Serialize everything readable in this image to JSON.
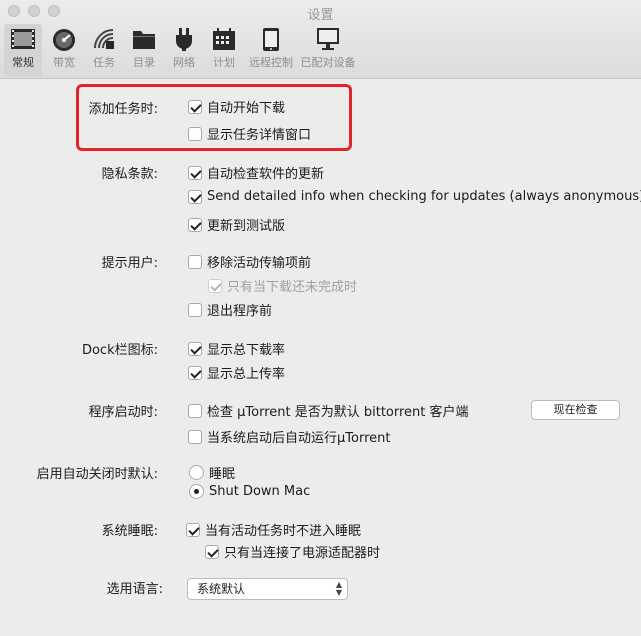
{
  "window": {
    "title": "设置"
  },
  "toolbar": {
    "tabs": [
      {
        "label": "常规"
      },
      {
        "label": "带宽"
      },
      {
        "label": "任务"
      },
      {
        "label": "目录"
      },
      {
        "label": "网络"
      },
      {
        "label": "计划"
      },
      {
        "label": "远程控制"
      },
      {
        "label": "已配对设备"
      }
    ],
    "active_tab": "常规"
  },
  "sections": {
    "add_task": {
      "label": "添加任务时:",
      "options": [
        {
          "text": "自动开始下载",
          "checked": true
        },
        {
          "text": "显示任务详情窗口",
          "checked": false
        }
      ]
    },
    "privacy": {
      "label": "隐私条款:",
      "options": [
        {
          "text": "自动检查软件的更新",
          "checked": true
        },
        {
          "text": "Send detailed info when checking for updates (always anonymous)",
          "checked": true
        },
        {
          "text": "更新到测试版",
          "checked": true
        }
      ]
    },
    "notify": {
      "label": "提示用户:",
      "options": [
        {
          "text": "移除活动传输项前",
          "checked": false
        },
        {
          "text": "只有当下载还未完成时",
          "checked": true,
          "disabled": true
        },
        {
          "text": "退出程序前",
          "checked": false
        }
      ]
    },
    "dock": {
      "label": "Dock栏图标:",
      "options": [
        {
          "text": "显示总下载率",
          "checked": true
        },
        {
          "text": "显示总上传率",
          "checked": true
        }
      ]
    },
    "startup": {
      "label": "程序启动时:",
      "options": [
        {
          "text": "检查 µTorrent 是否为默认 bittorrent 客户端",
          "checked": false
        },
        {
          "text": "当系统启动后自动运行µTorrent",
          "checked": false
        }
      ],
      "check_now_button": "现在检查"
    },
    "auto_shutdown": {
      "label": "启用自动关闭时默认:",
      "options": [
        {
          "text": "睡眠",
          "selected": false
        },
        {
          "text": "Shut Down Mac",
          "selected": true
        }
      ]
    },
    "sleep": {
      "label": "系统睡眠:",
      "options": [
        {
          "text": "当有活动任务时不进入睡眠",
          "checked": true
        },
        {
          "text": "只有当连接了电源适配器时",
          "checked": true
        }
      ]
    },
    "language": {
      "label": "选用语言:",
      "selected": "系统默认"
    }
  },
  "colors": {
    "highlight": "#e0262a",
    "background": "#ececec"
  }
}
